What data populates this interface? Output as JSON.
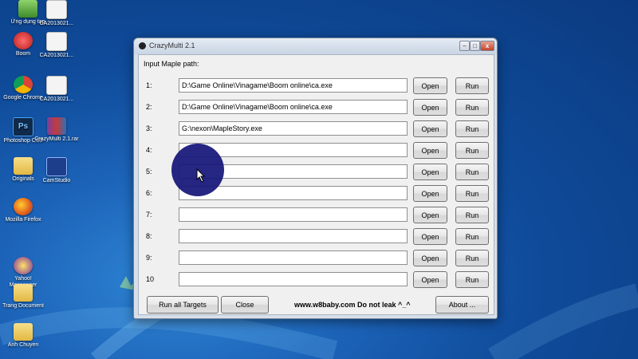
{
  "desktop": {
    "icons": [
      {
        "label": "Ứng dụng tap",
        "icon": "app-icon"
      },
      {
        "label": "CA2013021...",
        "icon": "doc-icon"
      },
      {
        "label": "Boom",
        "icon": "game-icon"
      },
      {
        "label": "CA2013021...",
        "icon": "doc-icon"
      },
      {
        "label": "Google Chrome",
        "icon": "chrome-icon"
      },
      {
        "label": "CA2013021...",
        "icon": "doc-icon"
      },
      {
        "label": "Photoshop CS3",
        "icon": "photoshop-icon",
        "badge": "Ps"
      },
      {
        "label": "CrazyMulti 2.1.rar",
        "icon": "archive-icon"
      },
      {
        "label": "Originals",
        "icon": "folder-icon"
      },
      {
        "label": "CamStudio",
        "icon": "camstudio-icon"
      },
      {
        "label": "Mozilla Firefox",
        "icon": "firefox-icon"
      },
      {
        "label": "Yahoo! Messenger",
        "icon": "yahoo-icon"
      },
      {
        "label": "Trang Document",
        "icon": "folder-icon"
      },
      {
        "label": "Anh Chuyen",
        "icon": "folder-icon"
      }
    ]
  },
  "window": {
    "title": "CrazyMulti 2.1",
    "controls": {
      "minimize": "–",
      "maximize": "□",
      "close": "x"
    },
    "heading": "Input Maple path:",
    "rows": [
      {
        "label": "1:",
        "path": "D:\\Game Online\\Vinagame\\Boom online\\ca.exe",
        "open": "Open",
        "run": "Run"
      },
      {
        "label": "2:",
        "path": "D:\\Game Online\\Vinagame\\Boom online\\ca.exe",
        "open": "Open",
        "run": "Run"
      },
      {
        "label": "3:",
        "path": "G:\\nexon\\MapleStory.exe",
        "open": "Open",
        "run": "Run"
      },
      {
        "label": "4:",
        "path": "",
        "open": "Open",
        "run": "Run"
      },
      {
        "label": "5:",
        "path": "",
        "open": "Open",
        "run": "Run"
      },
      {
        "label": "6:",
        "path": "",
        "open": "Open",
        "run": "Run"
      },
      {
        "label": "7:",
        "path": "",
        "open": "Open",
        "run": "Run"
      },
      {
        "label": "8:",
        "path": "",
        "open": "Open",
        "run": "Run"
      },
      {
        "label": "9:",
        "path": "",
        "open": "Open",
        "run": "Run"
      },
      {
        "label": "10",
        "path": "",
        "open": "Open",
        "run": "Run"
      }
    ],
    "footer": {
      "run_all": "Run all Targets",
      "close": "Close",
      "link": "www.w8baby.com  Do not leak ^_^",
      "about": "About ..."
    }
  },
  "colors": {
    "desktop": "#1c63b8",
    "cursor_highlight": "#15167a",
    "close_button": "#c4442c"
  }
}
